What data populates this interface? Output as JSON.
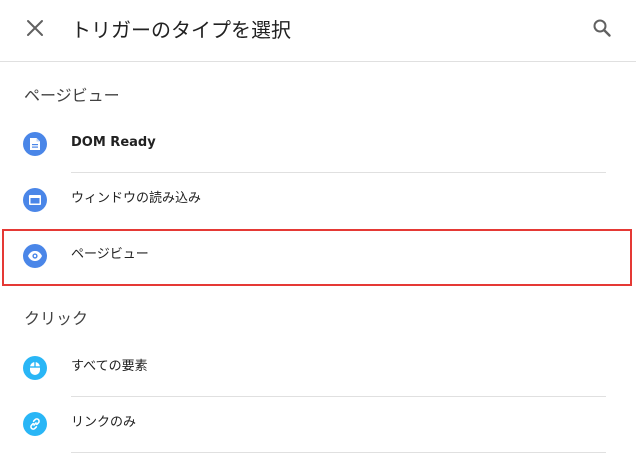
{
  "header": {
    "title": "トリガーのタイプを選択",
    "close_icon": "close-icon",
    "search_icon": "search-icon"
  },
  "sections": [
    {
      "title": "ページビュー",
      "items": [
        {
          "label": "DOM Ready",
          "icon": "document-icon",
          "color": "#4a86e8"
        },
        {
          "label": "ウィンドウの読み込み",
          "icon": "window-icon",
          "color": "#4a86e8"
        },
        {
          "label": "ページビュー",
          "icon": "eye-icon",
          "color": "#4a86e8",
          "highlighted": true
        }
      ]
    },
    {
      "title": "クリック",
      "items": [
        {
          "label": "すべての要素",
          "icon": "mouse-icon",
          "color": "#29b6f6"
        },
        {
          "label": "リンクのみ",
          "icon": "link-icon",
          "color": "#29b6f6"
        }
      ]
    }
  ],
  "colors": {
    "pageview_accent": "#4a86e8",
    "click_accent": "#29b6f6",
    "highlight_border": "#e53935"
  }
}
